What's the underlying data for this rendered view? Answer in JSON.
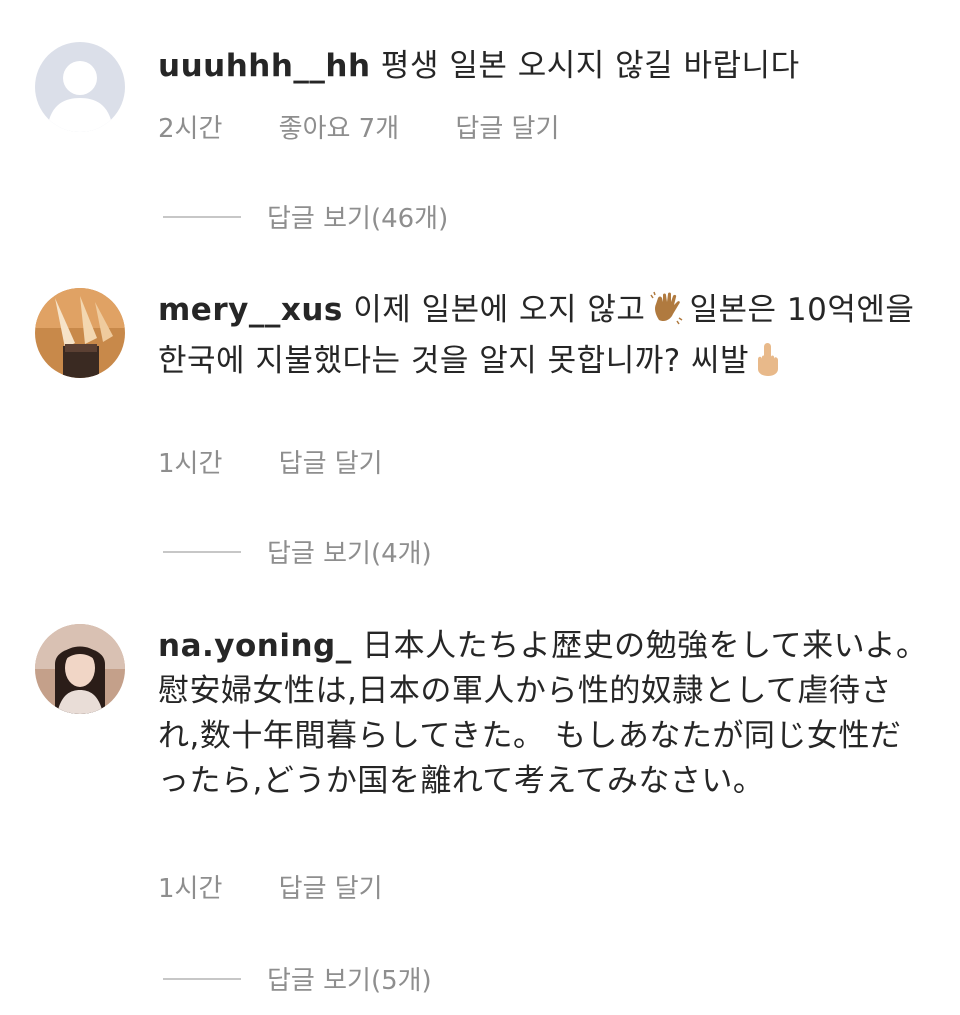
{
  "comments": [
    {
      "username": "uuuhhh__hh",
      "text": "평생 일본 오시지 않길 바랍니다",
      "time": "2시간",
      "likes": "좋아요 7개",
      "reply_label": "답글 달기",
      "view_replies": "답글 보기(46개)",
      "avatar": "default-avatar-icon"
    },
    {
      "username": "mery__xus",
      "text_before_emoji": "이제 일본에 오지 않고",
      "emoji_1": "waving-hand-icon",
      "text_after_emoji": "일본은 10억엔을 한국에 지불했다는 것을 알지 못합니까? 씨발",
      "emoji_2": "middle-finger-icon",
      "time": "1시간",
      "reply_label": "답글 달기",
      "view_replies": "답글 보기(4개)",
      "avatar": "photo-avatar"
    },
    {
      "username": "na.yoning_",
      "text": "日本人たちよ歴史の勉強をして来いよ。慰安婦女性は,日本の軍人から性的奴隷として虐待され,数十年間暮らしてきた。 もしあなたが同じ女性だったら,どうか国を離れて考えてみなさい。",
      "time": "1시간",
      "reply_label": "답글 달기",
      "view_replies": "답글 보기(5개)",
      "avatar": "photo-avatar"
    }
  ]
}
